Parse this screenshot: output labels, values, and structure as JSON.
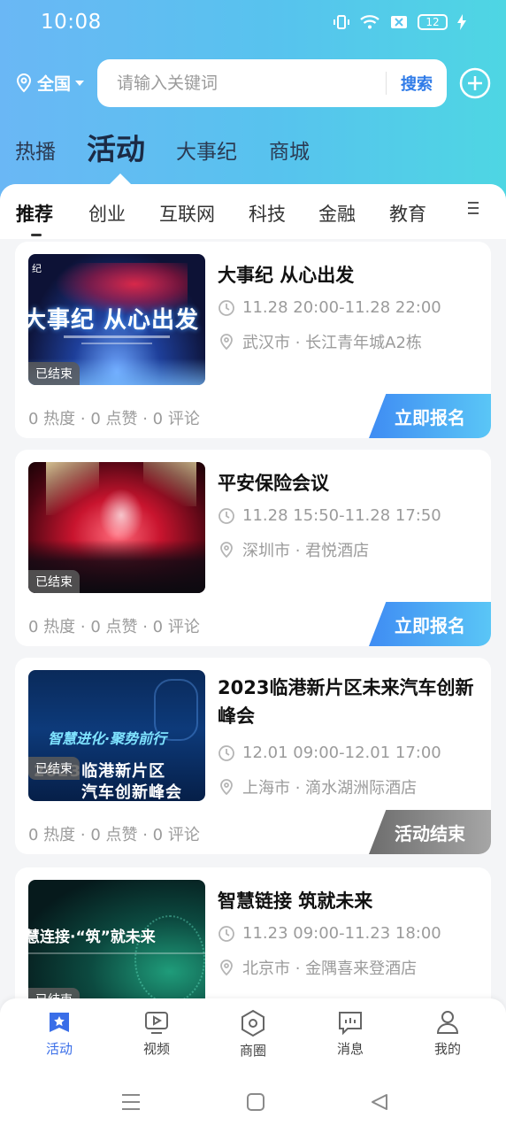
{
  "status_bar": {
    "time": "10:08",
    "battery": "12"
  },
  "header": {
    "location": "全国",
    "search_placeholder": "请输入关键词",
    "search_button": "搜索",
    "tabs": [
      "热播",
      "活动",
      "大事纪",
      "商城"
    ],
    "active_tab": "活动"
  },
  "categories": [
    "推荐",
    "创业",
    "互联网",
    "科技",
    "金融",
    "教育"
  ],
  "events": [
    {
      "title": "大事纪 从心出发",
      "time": "11.28 20:00-11.28 22:00",
      "place": "武汉市 · 长江青年城A2栋",
      "badge": "已结束",
      "stats": "0 热度 · 0 点赞 · 0 评论",
      "action": "立即报名",
      "thumb_text": "大事纪 从心出发",
      "thumb_small": "纪"
    },
    {
      "title": "平安保险会议",
      "time": "11.28 15:50-11.28 17:50",
      "place": "深圳市 · 君悦酒店",
      "badge": "已结束",
      "stats": "0 热度 · 0 点赞 · 0 评论",
      "action": "立即报名"
    },
    {
      "title": "2023临港新片区未来汽车创新峰会",
      "time": "12.01 09:00-12.01 17:00",
      "place": "上海市 · 滴水湖洲际酒店",
      "badge": "已结束",
      "stats": "0 热度 · 0 点赞 · 0 评论",
      "action": "活动结束",
      "thumb_line1": "智慧进化·聚势前行",
      "thumb_line2": "2023临港新片区",
      "thumb_line3": "汽车创新峰会"
    },
    {
      "title": "智慧链接 筑就未来",
      "time": "11.23 09:00-11.23 18:00",
      "place": "北京市 · 金隅喜来登酒店",
      "badge": "已结束",
      "thumb_line1": "慧连接·“筑”就未来"
    }
  ],
  "bottom_nav": [
    "活动",
    "视频",
    "商圈",
    "消息",
    "我的"
  ],
  "colors": {
    "accent": "#3a6ee8",
    "header_gradient_start": "#6ab7f5",
    "header_gradient_end": "#4ed6e3"
  }
}
